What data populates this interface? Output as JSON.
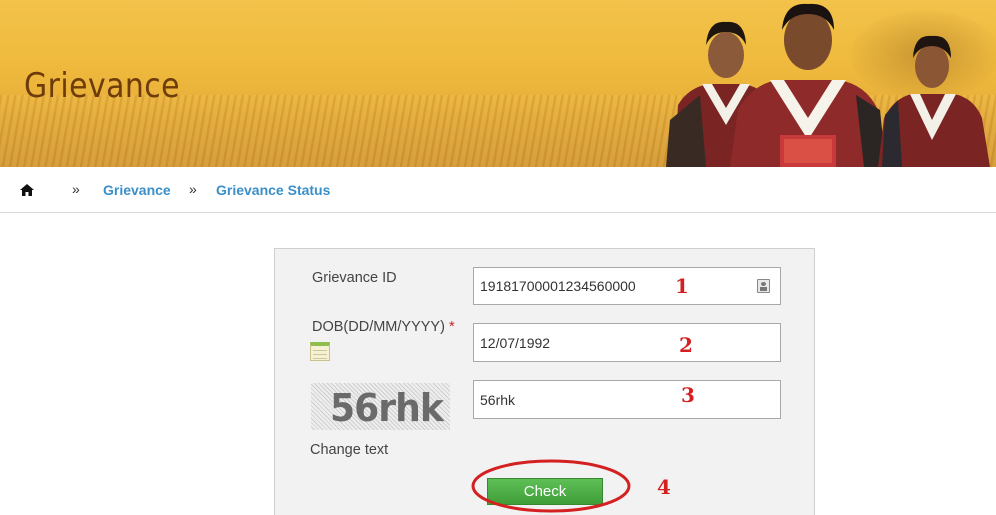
{
  "banner": {
    "title": "Grievance"
  },
  "breadcrumb": {
    "home_icon": "home-icon",
    "separator": "»",
    "items": [
      "Grievance",
      "Grievance Status"
    ]
  },
  "form": {
    "grievance_id": {
      "label": "Grievance ID",
      "value": "19181700001234560000",
      "icon": "id-card-icon"
    },
    "dob": {
      "label": "DOB(DD/MM/YYYY)",
      "required_mark": "*",
      "value": "12/07/1992",
      "icon": "calendar-icon"
    },
    "captcha": {
      "image_text": "56rhk",
      "value": "56rhk",
      "change_label": "Change text"
    },
    "submit_label": "Check"
  },
  "annotations": {
    "numbers": [
      "1",
      "2",
      "3",
      "4"
    ],
    "color": "#d42020"
  },
  "colors": {
    "link": "#3a8fc9",
    "button": "#4aa843",
    "banner_title": "#6e3c0a"
  }
}
